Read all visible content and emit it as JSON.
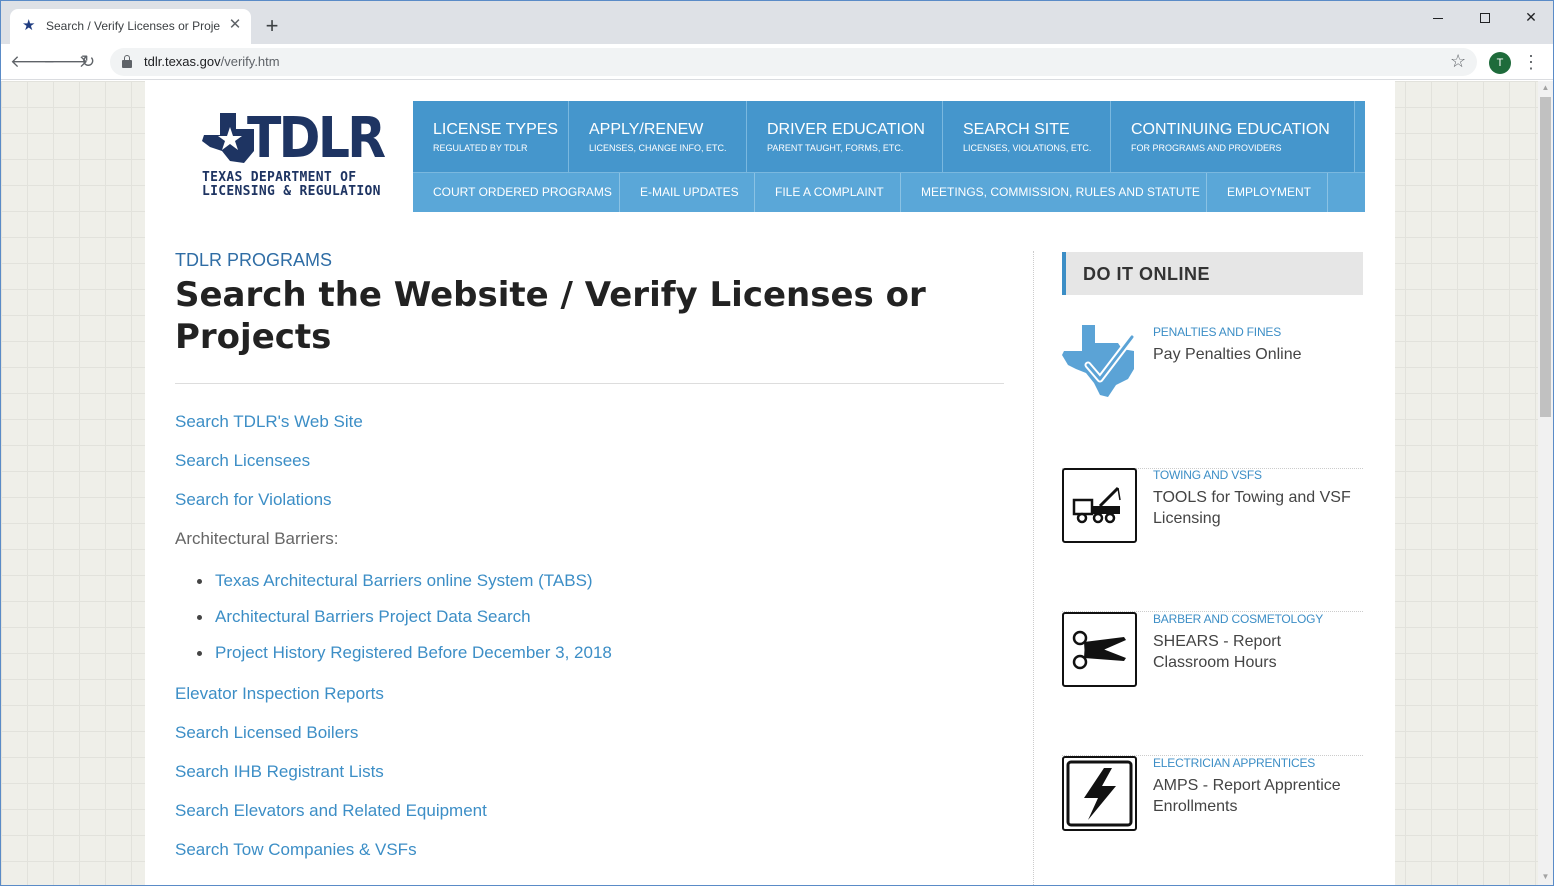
{
  "browser": {
    "tab_title": "Search / Verify Licenses or Projec",
    "new_tab": "+",
    "url_host": "tdlr.texas.gov",
    "url_path": "/verify.htm",
    "profile_initial": "T",
    "win_close": "✕"
  },
  "logo": {
    "name": "TDLR",
    "line1": "TEXAS DEPARTMENT OF",
    "line2": "LICENSING & REGULATION"
  },
  "nav": {
    "primary": [
      {
        "title": "LICENSE TYPES",
        "sub": "REGULATED BY TDLR"
      },
      {
        "title": "APPLY/RENEW",
        "sub": "LICENSES, CHANGE INFO, ETC."
      },
      {
        "title": "DRIVER EDUCATION",
        "sub": "PARENT TAUGHT, FORMS, ETC."
      },
      {
        "title": "SEARCH SITE",
        "sub": "LICENSES, VIOLATIONS, ETC."
      },
      {
        "title": "CONTINUING EDUCATION",
        "sub": "FOR PROGRAMS AND PROVIDERS"
      }
    ],
    "secondary": [
      "COURT ORDERED PROGRAMS",
      "E-MAIL UPDATES",
      "FILE A COMPLAINT",
      "MEETINGS, COMMISSION, RULES AND STATUTE",
      "EMPLOYMENT"
    ]
  },
  "main": {
    "kicker": "TDLR PROGRAMS",
    "heading": "Search the Website / Verify Licenses or Projects",
    "links_top": [
      "Search TDLR's Web Site",
      "Search Licensees",
      "Search for Violations"
    ],
    "barriers_label": "Architectural Barriers:",
    "barriers_links": [
      "Texas Architectural Barriers online System (TABS)",
      "Architectural Barriers Project Data Search",
      "Project History Registered Before December 3, 2018"
    ],
    "links_bottom": [
      "Elevator Inspection Reports",
      "Search Licensed Boilers",
      "Search IHB Registrant Lists",
      "Search Elevators and Related Equipment",
      "Search Tow Companies & VSFs"
    ]
  },
  "sidebar": {
    "heading": "DO IT ONLINE",
    "cards": [
      {
        "category": "Penalties and Fines",
        "title": "Pay Penalties Online",
        "icon": "texas-check-icon"
      },
      {
        "category": "Towing and VSFs",
        "title": "TOOLS for Towing and VSF Licensing",
        "icon": "tow-truck-icon"
      },
      {
        "category": "Barber and Cosmetology",
        "title": "SHEARS - Report Classroom Hours",
        "icon": "scissors-icon"
      },
      {
        "category": "Electrician Apprentices",
        "title": "AMPS - Report Apprentice Enrollments",
        "icon": "lightning-icon"
      }
    ]
  },
  "colors": {
    "brand_navy": "#1e3462",
    "nav_blue": "#4596cc",
    "link_blue": "#3c8ec6"
  }
}
